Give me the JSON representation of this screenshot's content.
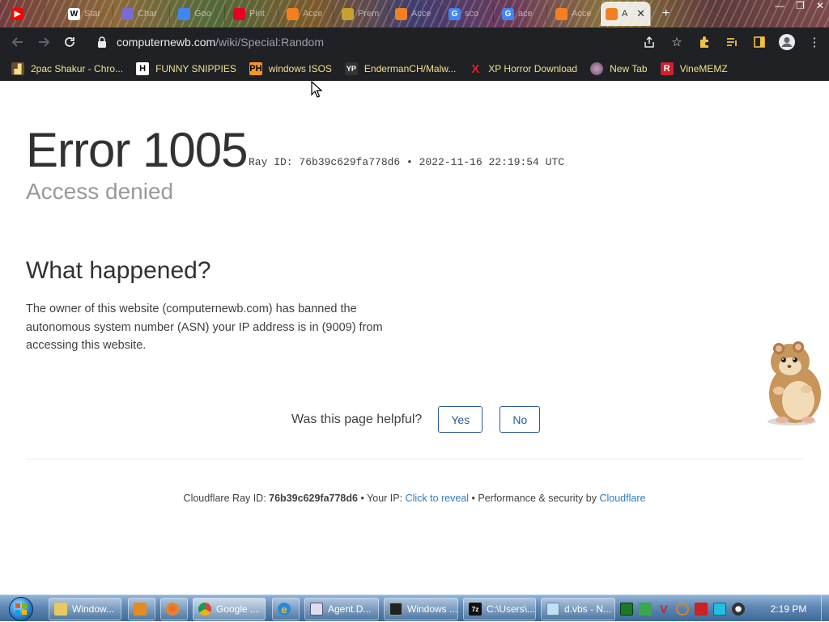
{
  "browser": {
    "tabs": [
      {
        "label": "",
        "favicon": "youtube-icon",
        "color": "#ff0000"
      },
      {
        "label": "Star",
        "favicon": "wikipedia-icon",
        "color": "#ffffff"
      },
      {
        "label": "Char",
        "favicon": "chat-icon",
        "color": "#7a6ad1"
      },
      {
        "label": "Goo",
        "favicon": "google-icon",
        "color": "#4285f4"
      },
      {
        "label": "Pint",
        "favicon": "pinterest-icon",
        "color": "#e60023"
      },
      {
        "label": "Acce",
        "favicon": "cloudflare-icon",
        "color": "#f38020"
      },
      {
        "label": "Prem",
        "favicon": "premium-icon",
        "color": "#c8a032"
      },
      {
        "label": "Acce",
        "favicon": "cloudflare-icon",
        "color": "#f38020"
      },
      {
        "label": "sco",
        "favicon": "google-icon",
        "color": "#4285f4"
      },
      {
        "label": "ace",
        "favicon": "google-icon",
        "color": "#4285f4"
      },
      {
        "label": "Acce",
        "favicon": "cloudflare-icon",
        "color": "#f38020"
      },
      {
        "label": "A",
        "favicon": "cloudflare-icon",
        "color": "#f38020",
        "active": true
      }
    ],
    "address": {
      "domain": "computernewb.com",
      "path": "/wiki/Special:Random"
    },
    "bookmarks": [
      {
        "label": "2pac Shakur - Chro...",
        "icon": "bookmark-icon"
      },
      {
        "label": "FUNNY SNIPPIES",
        "icon": "h-icon"
      },
      {
        "label": "windows ISOS",
        "icon": "ph-icon"
      },
      {
        "label": "EndermanCH/Malw...",
        "icon": "github-icon"
      },
      {
        "label": "XP Horror Download",
        "icon": "x-icon"
      },
      {
        "label": "New Tab",
        "icon": "globe-icon"
      },
      {
        "label": "VineMEMZ",
        "icon": "r-icon"
      }
    ]
  },
  "page": {
    "error_title": "Error 1005",
    "ray_meta": "Ray ID: 76b39c629fa778d6 • 2022-11-16 22:19:54 UTC",
    "subtitle": "Access denied",
    "what_heading": "What happened?",
    "what_body": "The owner of this website (computernewb.com) has banned the autonomous system number (ASN) your IP address is in (9009) from accessing this website.",
    "helpful_label": "Was this page helpful?",
    "yes_label": "Yes",
    "no_label": "No",
    "footer": {
      "ray_prefix": "Cloudflare Ray ID: ",
      "ray_id": "76b39c629fa778d6",
      "ip_prefix": " • Your IP: ",
      "ip_link": "Click to reveal",
      "perf_prefix": " • Performance & security by ",
      "cloudflare_link": "Cloudflare"
    }
  },
  "taskbar": {
    "items": [
      {
        "label": "Window...",
        "icon": "folder-icon"
      },
      {
        "label": "",
        "icon": "media-player-icon"
      },
      {
        "label": "",
        "icon": "paint-icon"
      },
      {
        "label": "Google ...",
        "icon": "chrome-icon"
      },
      {
        "label": "",
        "icon": "ie-icon"
      },
      {
        "label": "Agent.D...",
        "icon": "app-icon"
      },
      {
        "label": "Windows ...",
        "icon": "terminal-icon"
      },
      {
        "label": "C:\\Users\\...",
        "icon": "7zip-icon"
      },
      {
        "label": "d.vbs - N...",
        "icon": "notepad-icon"
      }
    ],
    "clock": "2:19 PM"
  },
  "colors": {
    "link": "#2f7bbf",
    "button_border": "#2c5b94",
    "chrome_dark": "#202124",
    "bookmark_text": "#f0e08a"
  }
}
